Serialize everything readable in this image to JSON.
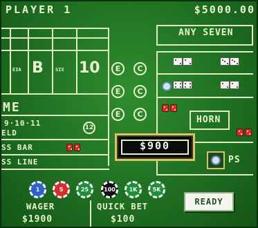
{
  "header": {
    "player_label": "PLAYER 1",
    "bankroll": "$5000.00"
  },
  "table": {
    "any_seven": "ANY SEVEN",
    "horn": "HORN",
    "big_label": "B",
    "ten_label": "10",
    "come_label": "ME",
    "field_numbers": "9·10·11",
    "field_label": "ELD",
    "field_badge": "12",
    "dont_pass_label": "SS BAR",
    "pass_line_label": "SS LINE",
    "craps_label": "PS",
    "ec_letters": [
      "E",
      "C"
    ],
    "small_labels": [
      "EIA",
      "SIX"
    ]
  },
  "bet_display": {
    "value": "$900"
  },
  "chips": [
    {
      "label": "1",
      "color": "#2f63c9"
    },
    {
      "label": "5",
      "color": "#d4302b"
    },
    {
      "label": "25",
      "color": "#1f8f3a"
    },
    {
      "label": "100",
      "color": "#111111"
    },
    {
      "label": "1K",
      "color": "#1f8f3a"
    },
    {
      "label": "5K",
      "color": "#1f8f3a"
    }
  ],
  "footer": {
    "wager_label": "WAGER",
    "wager_value": "$1900",
    "quick_bet_label": "QUICK BET",
    "quick_bet_value": "$100",
    "ready_label": "READY"
  },
  "colors": {
    "felt": "#1f6f22",
    "felt_dark": "#145516",
    "line": "#dfeec0",
    "display_frame": "#d8c26a"
  }
}
